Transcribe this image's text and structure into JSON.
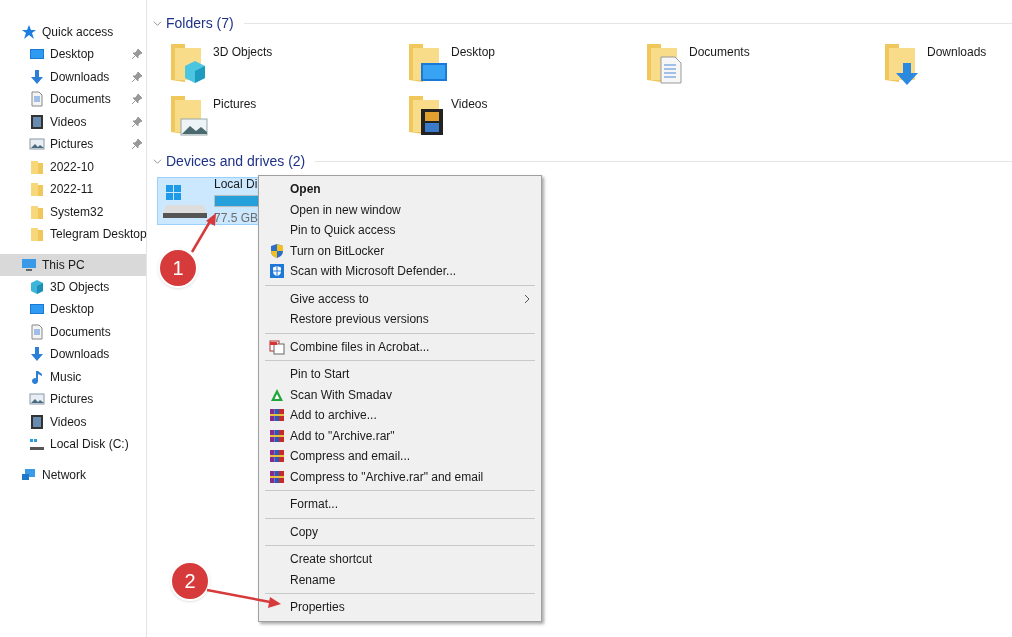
{
  "sidebar": {
    "items": [
      {
        "label": "Quick access",
        "kind": "star",
        "selected": false,
        "children": [
          {
            "label": "Desktop",
            "kind": "desktop",
            "pinned": true
          },
          {
            "label": "Downloads",
            "kind": "downloads",
            "pinned": true
          },
          {
            "label": "Documents",
            "kind": "documents",
            "pinned": true
          },
          {
            "label": "Videos",
            "kind": "videos",
            "pinned": true
          },
          {
            "label": "Pictures",
            "kind": "pictures",
            "pinned": true
          },
          {
            "label": "2022-10",
            "kind": "folder",
            "pinned": false
          },
          {
            "label": "2022-11",
            "kind": "folder",
            "pinned": false
          },
          {
            "label": "System32",
            "kind": "folder",
            "pinned": false
          },
          {
            "label": "Telegram Desktop",
            "kind": "folder",
            "pinned": false
          }
        ]
      },
      {
        "label": "This PC",
        "kind": "pc",
        "selected": true,
        "children": [
          {
            "label": "3D Objects",
            "kind": "objects",
            "pinned": false
          },
          {
            "label": "Desktop",
            "kind": "desktop",
            "pinned": false
          },
          {
            "label": "Documents",
            "kind": "documents",
            "pinned": false
          },
          {
            "label": "Downloads",
            "kind": "downloads",
            "pinned": false
          },
          {
            "label": "Music",
            "kind": "music",
            "pinned": false
          },
          {
            "label": "Pictures",
            "kind": "pictures",
            "pinned": false
          },
          {
            "label": "Videos",
            "kind": "videos",
            "pinned": false
          },
          {
            "label": "Local Disk (C:)",
            "kind": "disk",
            "pinned": false
          }
        ]
      },
      {
        "label": "Network",
        "kind": "network",
        "selected": false
      }
    ]
  },
  "folders": {
    "title": "Folders (7)",
    "items": [
      {
        "label": "3D Objects",
        "kind": "objects"
      },
      {
        "label": "Desktop",
        "kind": "desktop"
      },
      {
        "label": "Documents",
        "kind": "documents"
      },
      {
        "label": "Downloads",
        "kind": "downloads"
      },
      {
        "label": "Pictures",
        "kind": "pictures"
      },
      {
        "label": "Videos",
        "kind": "videos"
      }
    ]
  },
  "devices": {
    "title": "Devices and drives (2)",
    "items": [
      {
        "label": "Local Di",
        "detail": "77.5 GB",
        "level": 0.7,
        "selected": true
      }
    ]
  },
  "context_menu": {
    "items": [
      {
        "label": "Open",
        "kind": "plain",
        "default": true
      },
      {
        "label": "Open in new window",
        "kind": "plain",
        "default": false
      },
      {
        "label": "Pin to Quick access",
        "kind": "plain",
        "default": false
      },
      {
        "label": "Turn on BitLocker",
        "kind": "shield",
        "default": false
      },
      {
        "label": "Scan with Microsoft Defender...",
        "kind": "defender",
        "default": false
      },
      {
        "kind": "separator"
      },
      {
        "label": "Give access to",
        "kind": "submenu",
        "default": false
      },
      {
        "label": "Restore previous versions",
        "kind": "plain",
        "default": false
      },
      {
        "kind": "separator"
      },
      {
        "label": "Combine files in Acrobat...",
        "kind": "acrobat",
        "default": false
      },
      {
        "kind": "separator"
      },
      {
        "label": "Pin to Start",
        "kind": "plain",
        "default": false
      },
      {
        "label": "Scan With Smadav",
        "kind": "smadav",
        "default": false
      },
      {
        "label": "Add to archive...",
        "kind": "winrar",
        "default": false
      },
      {
        "label": "Add to \"Archive.rar\"",
        "kind": "winrar",
        "default": false
      },
      {
        "label": "Compress and email...",
        "kind": "winrar",
        "default": false
      },
      {
        "label": "Compress to \"Archive.rar\" and email",
        "kind": "winrar",
        "default": false
      },
      {
        "kind": "separator"
      },
      {
        "label": "Format...",
        "kind": "plain",
        "default": false
      },
      {
        "kind": "separator"
      },
      {
        "label": "Copy",
        "kind": "plain",
        "default": false
      },
      {
        "kind": "separator"
      },
      {
        "label": "Create shortcut",
        "kind": "plain",
        "default": false
      },
      {
        "label": "Rename",
        "kind": "plain",
        "default": false
      },
      {
        "kind": "separator"
      },
      {
        "label": "Properties",
        "kind": "plain",
        "default": false
      }
    ]
  },
  "annotations": [
    {
      "label": "1"
    },
    {
      "label": "2"
    }
  ]
}
